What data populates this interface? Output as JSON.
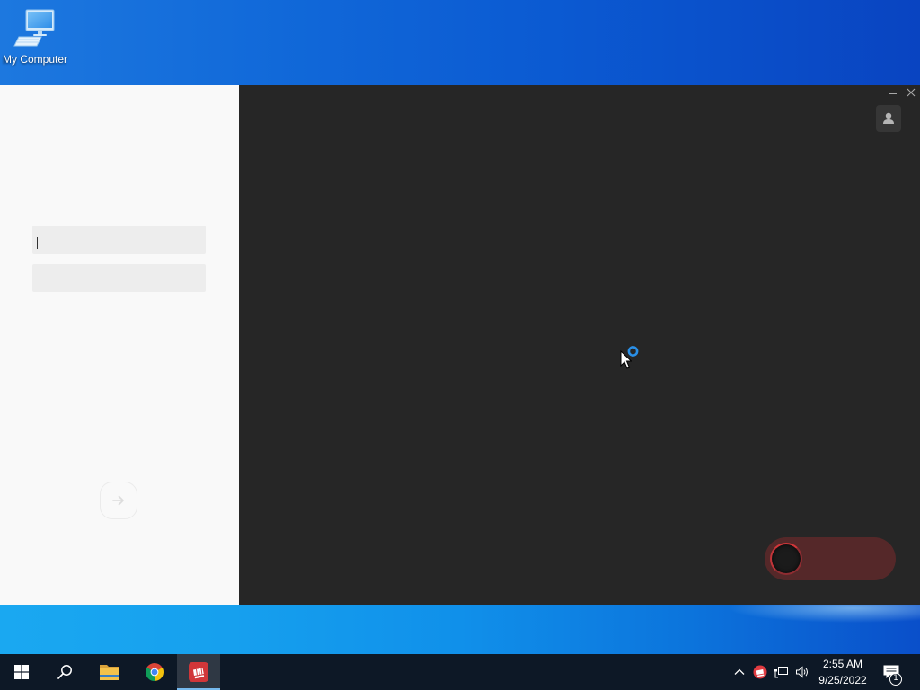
{
  "desktop": {
    "icons": [
      {
        "label": "My Computer",
        "icon": "computer-icon"
      }
    ]
  },
  "app_window": {
    "window_controls": [
      "minimize-icon",
      "close-icon"
    ],
    "login_form": {
      "fields": [
        {
          "value": "",
          "placeholder": ""
        },
        {
          "value": "",
          "placeholder": ""
        }
      ],
      "submit_icon": "arrow-right-icon"
    },
    "profile_button_icon": "user-icon"
  },
  "taskbar": {
    "buttons": [
      {
        "icon": "windows-logo-icon",
        "active": false
      },
      {
        "icon": "search-icon",
        "active": false
      },
      {
        "icon": "file-explorer-icon",
        "active": false
      },
      {
        "icon": "chrome-icon",
        "active": false
      },
      {
        "icon": "riot-client-icon",
        "active": true
      }
    ],
    "tray": {
      "icons": [
        "chevron-up-icon",
        "riot-client-tray-icon",
        "network-icon",
        "volume-icon"
      ],
      "time": "2:55 AM",
      "date": "9/25/2022",
      "notification_count": "1"
    }
  },
  "colors": {
    "left_panel_bg": "#f9f9f9",
    "right_panel_bg": "#262626",
    "field_bg": "#ededed",
    "brand_red": "#d13639",
    "pill_bg": "#552829",
    "taskbar_bg": "#0d1826",
    "active_indicator": "#76b9ed"
  }
}
